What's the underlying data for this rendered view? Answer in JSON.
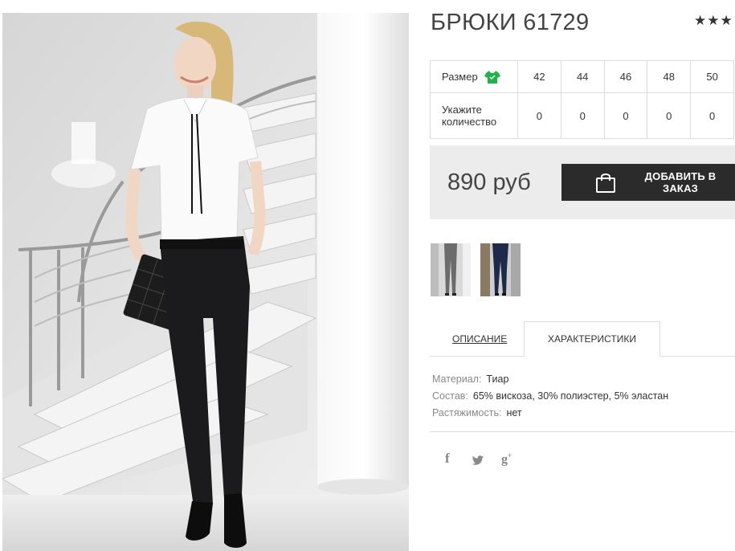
{
  "product": {
    "title": "БРЮКИ 61729",
    "rating_stars": "★★★"
  },
  "size_table": {
    "size_label": "Размер",
    "size_icon": "tshirt-icon",
    "quantity_label_line1": "Укажите",
    "quantity_label_line2": "количество",
    "sizes": [
      "42",
      "44",
      "46",
      "48",
      "50"
    ],
    "quantities": [
      "0",
      "0",
      "0",
      "0",
      "0"
    ]
  },
  "price": {
    "value": "890 руб",
    "add_button_label": "ДОБАВИТЬ В ЗАКАЗ",
    "button_icon": "shopping-bag-icon"
  },
  "tabs": {
    "description": "ОПИСАНИЕ",
    "characteristics": "ХАРАКТЕРИСТИКИ",
    "active": "characteristics"
  },
  "characteristics": [
    {
      "key": "Материал:",
      "value": "Тиар"
    },
    {
      "key": "Состав:",
      "value": "65% вискоза, 30% полиэстер, 5% эластан"
    },
    {
      "key": "Растяжимость:",
      "value": "нет"
    }
  ],
  "social": {
    "facebook": "f",
    "twitter_icon": "twitter-icon",
    "googleplus": "g",
    "googleplus_sup": "+"
  },
  "colors": {
    "button_bg": "#2b2b2b",
    "price_box_bg": "#ececec",
    "tshirt_icon": "#1fb34a"
  }
}
